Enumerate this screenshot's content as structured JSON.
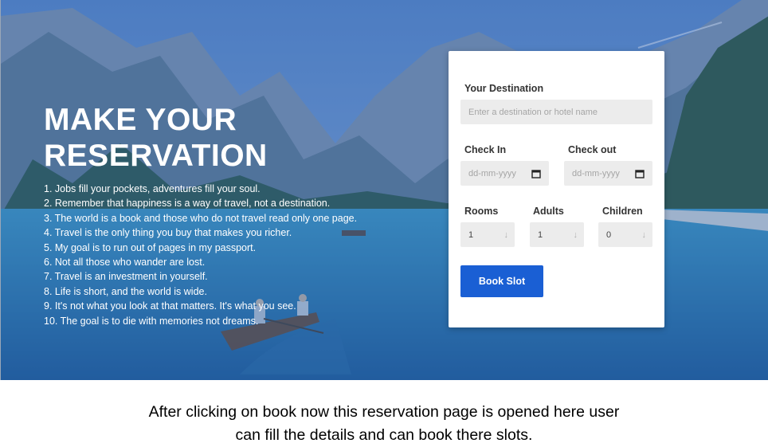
{
  "hero": {
    "title_line1": "MAKE YOUR",
    "title_line2": "RESERVATION",
    "quotes": [
      "1. Jobs fill your pockets, adventures fill your soul.",
      "2. Remember that happiness is a way of travel, not a destination.",
      "3. The world is a book and those who do not travel read only one page.",
      "4. Travel is the only thing you buy that makes you richer.",
      "5. My goal is to run out of pages in my passport.",
      "6. Not all those who wander are lost.",
      "7. Travel is an investment in yourself.",
      "8. Life is short, and the world is wide.",
      "9. It's not what you look at that matters. It's what you see.",
      "10. The goal is to die with memories not dreams."
    ]
  },
  "form": {
    "destination_label": "Your Destination",
    "destination_placeholder": "Enter a destination or hotel name",
    "checkin_label": "Check In",
    "checkout_label": "Check out",
    "date_placeholder": "dd-mm-yyyy",
    "rooms_label": "Rooms",
    "adults_label": "Adults",
    "children_label": "Children",
    "rooms_value": "1",
    "adults_value": "1",
    "children_value": "0",
    "book_button": "Book Slot"
  },
  "caption": {
    "line1": "After clicking on book now this reservation page is opened here user",
    "line2": "can fill the details and can book there slots."
  },
  "colors": {
    "accent": "#1a5fd4",
    "overlay": "#2d5aaa",
    "field_bg": "#ececec"
  },
  "icons": {
    "calendar": "calendar-icon",
    "select_arrow": "arrow-down-icon"
  }
}
